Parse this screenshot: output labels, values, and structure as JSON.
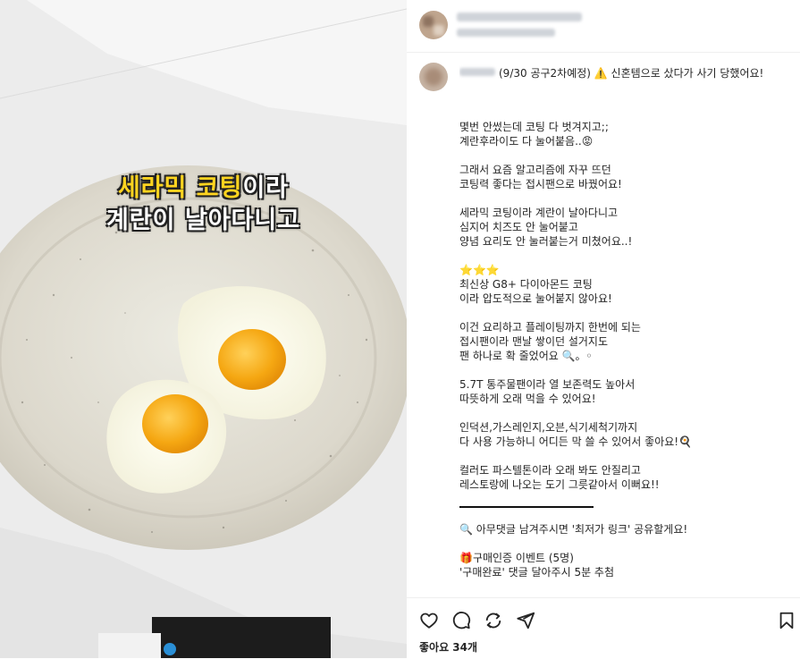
{
  "post": {
    "first_line": "(9/30 공구2차예정) ⚠️ 신혼템으로 샀다가 사기 당했어요!",
    "paragraphs": [
      "몇번 안썼는데 코팅 다 벗겨지고;;\n계란후라이도 다 눌어붙음..😡",
      "그래서 요즘 알고리즘에 자꾸 뜨던\n코팅력 좋다는 접시팬으로 바꿨어요!",
      "세라믹 코팅이라 계란이 날아다니고\n심지어 치즈도 안 눌어붙고\n양념 요리도 안 눌러붙는거 미쳤어요..!",
      "⭐⭐⭐\n최신상 G8+ 다이아몬드 코팅\n이라 압도적으로 눌어붙지 않아요!",
      "이건 요리하고 플레이팅까지 한번에 되는\n접시팬이라 맨날 쌓이던 설거지도\n팬 하나로 확 줄었어요 🔍。◦",
      "5.7T 통주물팬이라 열 보존력도 높아서\n따뜻하게 오래 먹을 수 있어요!",
      "인덕션,가스레인지,오븐,식기세척기까지\n다 사용 가능하니 어디든 막 쓸 수 있어서 좋아요!🍳",
      "컬러도 파스텔톤이라 오래 봐도 안질리고\n레스토랑에 나오는 도기 그릇같아서 이뻐요!!"
    ],
    "after_divider": [
      "🔍 아무댓글 남겨주시면 '최저가 링크' 공유할게요!",
      "🎁구매인증 이벤트 (5명)\n'구매완료' 댓글 달아주시 5분 추첨"
    ]
  },
  "media": {
    "overlay_line1_highlight1": "세라믹",
    "overlay_line1_highlight2": "코팅",
    "overlay_line1_rest": "이라",
    "overlay_line2": "계란이 날아다니고"
  },
  "footer": {
    "likes": "좋아요 34개"
  },
  "icons": [
    "heart-icon",
    "comment-icon",
    "share-icon",
    "send-icon",
    "bookmark-icon"
  ],
  "colors": {
    "highlight": "#ffd41f",
    "pan": "#d7d2c6",
    "text": "#262626"
  }
}
